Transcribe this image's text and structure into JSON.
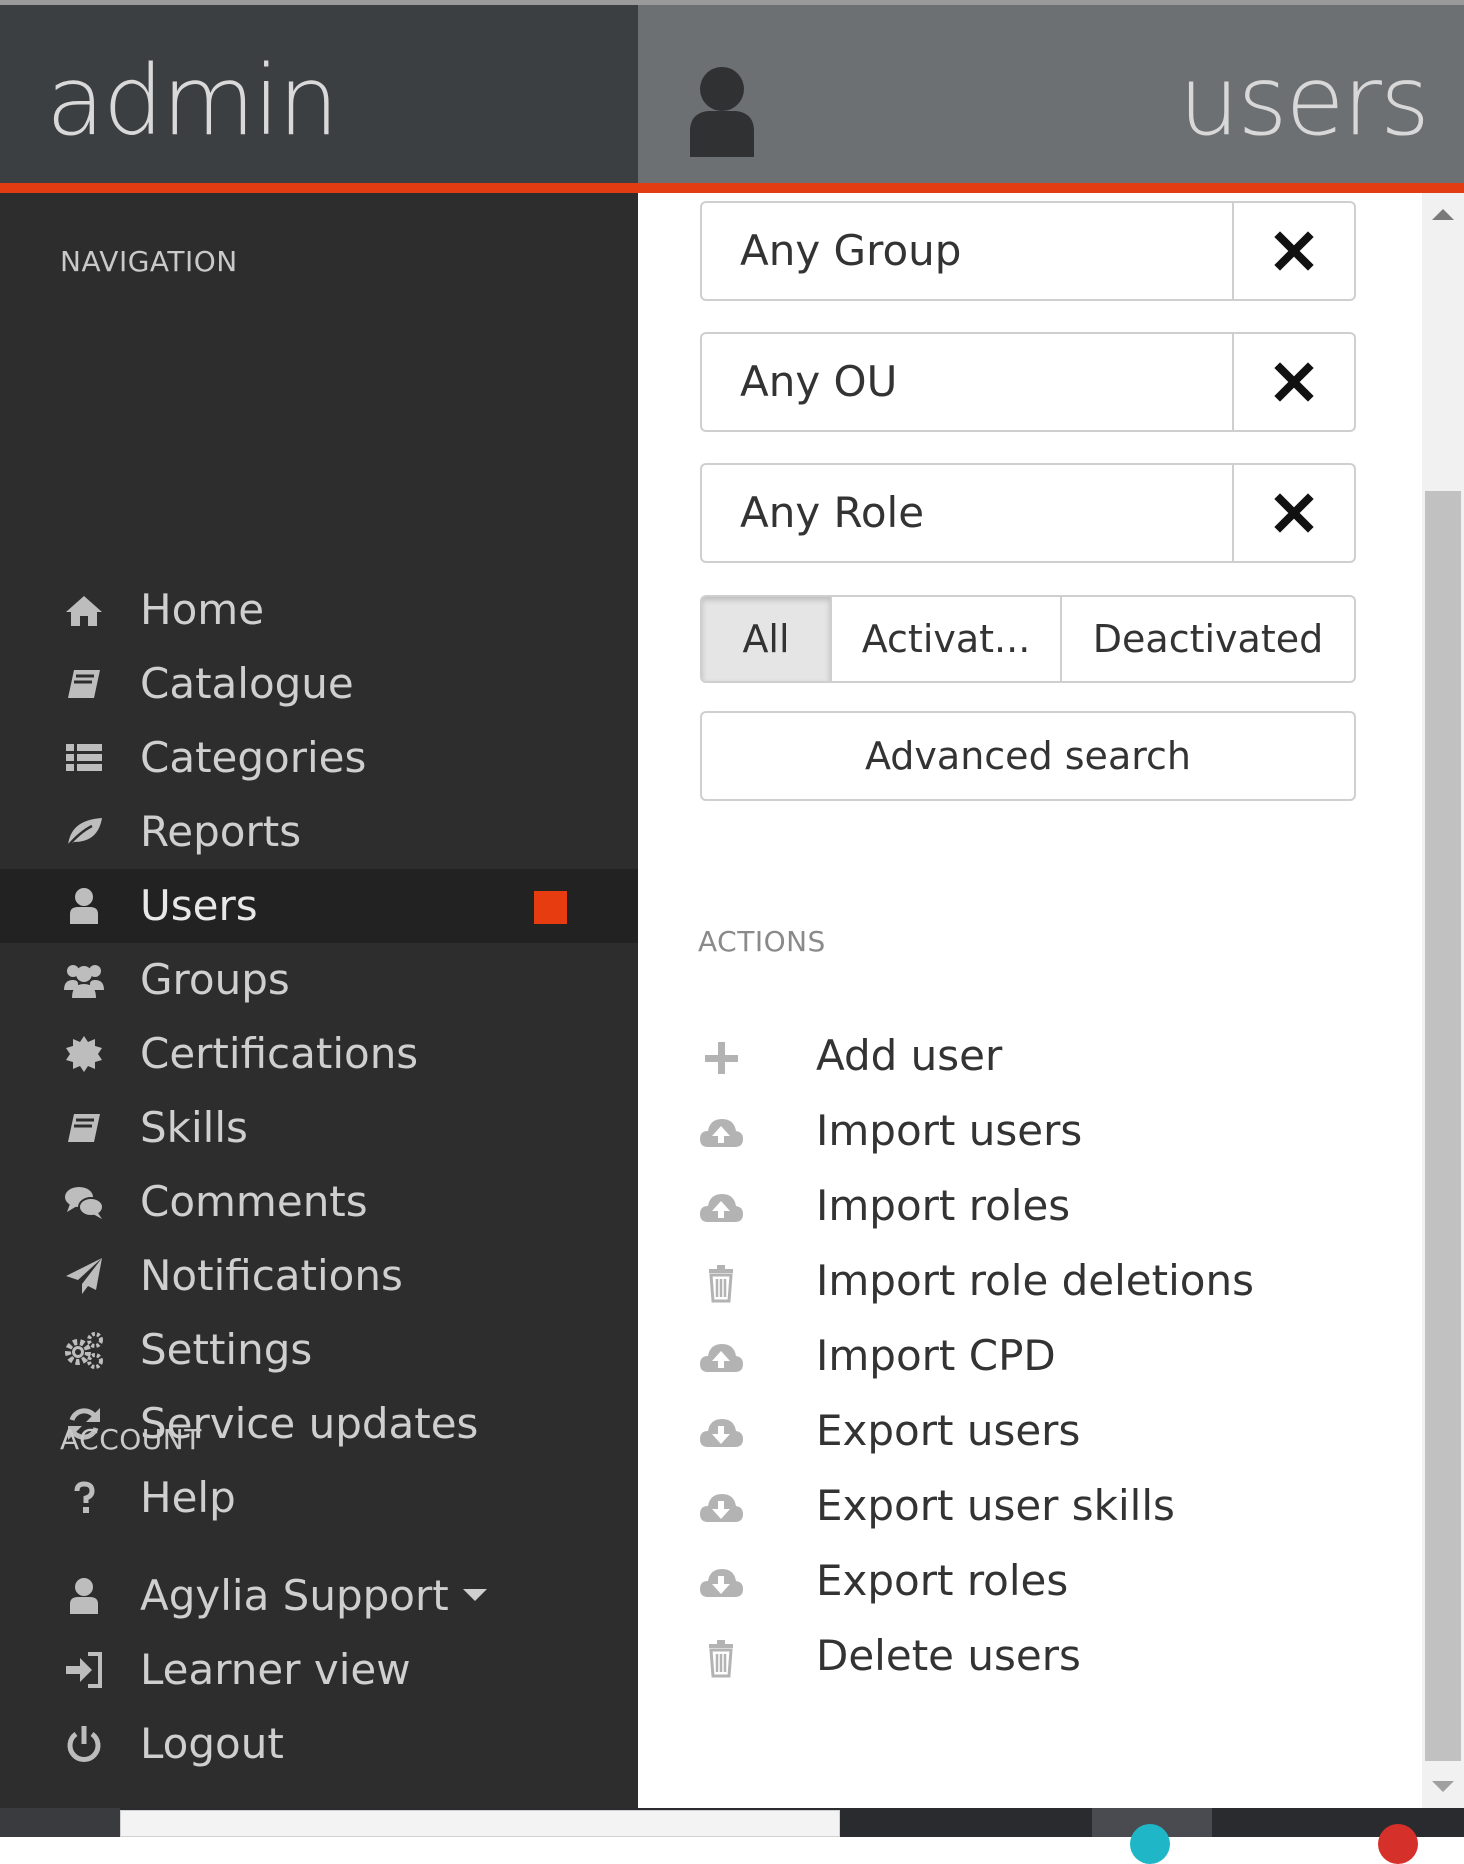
{
  "header": {
    "brand": "admin",
    "section_title": "users"
  },
  "icons": {
    "header_user": "user-icon",
    "clear": "times-icon"
  },
  "sidebar": {
    "navigation_heading": "NAVIGATION",
    "nav_items": [
      {
        "label": "Home",
        "icon": "home-icon"
      },
      {
        "label": "Catalogue",
        "icon": "book-icon"
      },
      {
        "label": "Categories",
        "icon": "list-icon"
      },
      {
        "label": "Reports",
        "icon": "leaf-icon"
      },
      {
        "label": "Users",
        "icon": "user-icon",
        "active": true
      },
      {
        "label": "Groups",
        "icon": "users-icon"
      },
      {
        "label": "Certifications",
        "icon": "certificate-icon"
      },
      {
        "label": "Skills",
        "icon": "book-icon"
      },
      {
        "label": "Comments",
        "icon": "comments-icon"
      },
      {
        "label": "Notifications",
        "icon": "paper-plane-icon"
      },
      {
        "label": "Settings",
        "icon": "cogs-icon"
      },
      {
        "label": "Service updates",
        "icon": "refresh-icon"
      },
      {
        "label": "Help",
        "icon": "question-icon"
      }
    ],
    "account_heading": "ACCOUNT",
    "account_items": [
      {
        "label": "Agylia Support",
        "icon": "user-icon",
        "dropdown": true
      },
      {
        "label": "Learner view",
        "icon": "sign-in-icon"
      },
      {
        "label": "Logout",
        "icon": "power-off-icon"
      }
    ]
  },
  "filters": {
    "group": "Any Group",
    "ou": "Any OU",
    "role": "Any Role",
    "status_options": [
      "All",
      "Activat...",
      "Deactivated"
    ],
    "selected_status": "All",
    "advanced_search": "Advanced search"
  },
  "actions": {
    "heading": "ACTIONS",
    "items": [
      {
        "label": "Add user",
        "icon": "plus-icon"
      },
      {
        "label": "Import users",
        "icon": "cloud-upload-icon"
      },
      {
        "label": "Import roles",
        "icon": "cloud-upload-icon"
      },
      {
        "label": "Import role deletions",
        "icon": "trash-icon"
      },
      {
        "label": "Import CPD",
        "icon": "cloud-upload-icon"
      },
      {
        "label": "Export users",
        "icon": "cloud-download-icon"
      },
      {
        "label": "Export user skills",
        "icon": "cloud-download-icon"
      },
      {
        "label": "Export roles",
        "icon": "cloud-download-icon"
      },
      {
        "label": "Delete users",
        "icon": "trash-icon"
      }
    ]
  },
  "colors": {
    "header_left": "#3c3f42",
    "header_right": "#6d7073",
    "accent": "#e23c12",
    "sidebar_bg": "#2d2d2d",
    "sidebar_active": "#222222"
  }
}
